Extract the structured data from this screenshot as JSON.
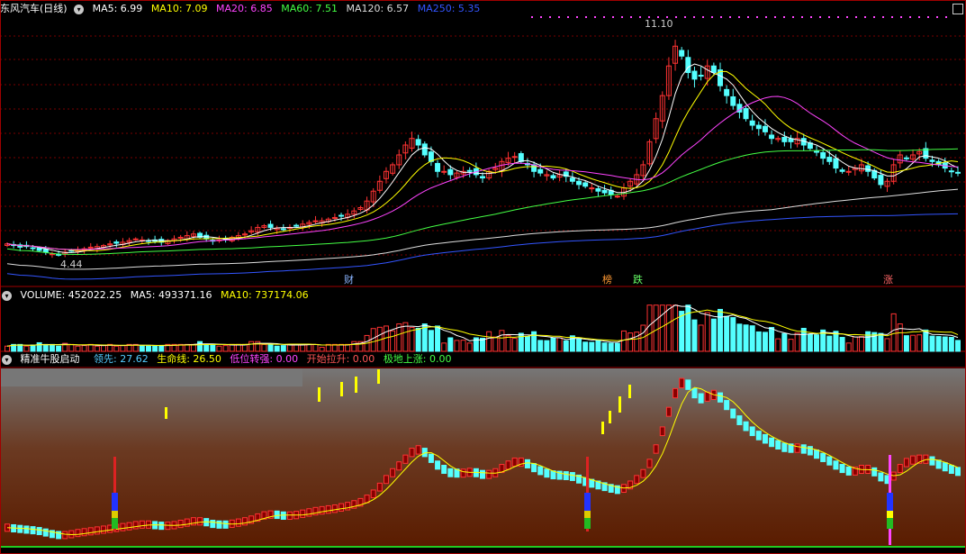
{
  "main": {
    "stock_name": "东风汽车(日线)",
    "ma": [
      {
        "label": "MA5: 6.99",
        "color": "#ffffff"
      },
      {
        "label": "MA10: 7.09",
        "color": "#ffff00"
      },
      {
        "label": "MA20: 6.85",
        "color": "#ff44ff"
      },
      {
        "label": "MA60: 7.51",
        "color": "#44ff44"
      },
      {
        "label": "MA120: 6.57",
        "color": "#dddddd"
      },
      {
        "label": "MA250: 5.35",
        "color": "#3355ff"
      }
    ],
    "high_label": "11.10",
    "low_label": "4.44",
    "tags": [
      {
        "text": "财",
        "color": "#8ab4ff"
      },
      {
        "text": "榜",
        "color": "#ff9933"
      },
      {
        "text": "跌",
        "color": "#66ff66"
      },
      {
        "text": "涨",
        "color": "#ff6666"
      }
    ]
  },
  "volume": {
    "title": "VOLUME: 452022.25",
    "ma5": "MA5: 493371.16",
    "ma10": "MA10: 737174.06"
  },
  "indicator": {
    "name": "精准牛股启动",
    "items": [
      {
        "label": "领先: 27.62",
        "color": "#55ccff"
      },
      {
        "label": "生命线: 26.50",
        "color": "#ffff00"
      },
      {
        "label": "低位转强: 0.00",
        "color": "#ff44ff"
      },
      {
        "label": "开始拉升: 0.00",
        "color": "#ff5555"
      },
      {
        "label": "极地上涨: 0.00",
        "color": "#44ff44"
      }
    ]
  },
  "colors": {
    "up": "#ff3333",
    "down": "#54ffff",
    "grid": "#7a0000",
    "ma5": "#ffffff",
    "ma10": "#ffff00",
    "ma20": "#ff44ff",
    "ma60": "#44ff44",
    "ma120": "#dddddd",
    "ma250": "#3355ff"
  },
  "chart_data": {
    "type": "candlestick",
    "price_range": [
      4.0,
      11.6
    ],
    "high": 11.1,
    "low": 4.44,
    "close_series": [
      4.8,
      4.75,
      4.7,
      4.72,
      4.68,
      4.6,
      4.55,
      4.5,
      4.48,
      4.55,
      4.6,
      4.62,
      4.65,
      4.7,
      4.72,
      4.75,
      4.8,
      4.82,
      4.85,
      4.9,
      4.95,
      4.92,
      4.9,
      4.88,
      4.85,
      4.9,
      4.95,
      5.0,
      5.05,
      5.1,
      5.0,
      4.95,
      4.9,
      4.92,
      4.95,
      5.0,
      5.05,
      5.1,
      5.2,
      5.3,
      5.35,
      5.3,
      5.28,
      5.25,
      5.3,
      5.35,
      5.4,
      5.45,
      5.5,
      5.5,
      5.55,
      5.6,
      5.65,
      5.7,
      5.8,
      5.9,
      6.1,
      6.4,
      6.7,
      7.0,
      7.2,
      7.5,
      7.8,
      8.0,
      7.8,
      7.5,
      7.3,
      7.0,
      7.0,
      6.9,
      6.95,
      7.0,
      7.0,
      6.9,
      6.8,
      7.0,
      7.1,
      7.3,
      7.4,
      7.45,
      7.3,
      7.2,
      7.0,
      6.95,
      6.9,
      6.8,
      6.9,
      6.85,
      6.7,
      6.6,
      6.55,
      6.5,
      6.4,
      6.35,
      6.3,
      6.25,
      6.5,
      6.7,
      6.9,
      7.2,
      7.9,
      8.6,
      9.3,
      10.2,
      10.8,
      10.5,
      10.0,
      9.8,
      9.9,
      10.2,
      10.0,
      9.6,
      9.3,
      9.0,
      8.8,
      8.6,
      8.4,
      8.3,
      8.2,
      8.0,
      8.0,
      7.9,
      7.9,
      8.0,
      7.8,
      7.7,
      7.6,
      7.4,
      7.3,
      7.1,
      7.0,
      7.0,
      7.1,
      7.2,
      7.0,
      6.8,
      6.6,
      6.7,
      7.2,
      7.5,
      7.4,
      7.5,
      7.6,
      7.4,
      7.3,
      7.2,
      7.1,
      7.0,
      6.95
    ],
    "volume_range": [
      0,
      3000000
    ],
    "volume_ma5": 493371.16,
    "volume_ma10": 737174.06,
    "volume_last": 452022.25,
    "indicator": {
      "lead": 27.62,
      "lifeline": 26.5,
      "low_strengthen": 0.0,
      "start_pull": 0.0,
      "polar_rise": 0.0
    },
    "signals": [
      {
        "index": 17
      },
      {
        "index": 91
      },
      {
        "index": 133
      }
    ]
  }
}
